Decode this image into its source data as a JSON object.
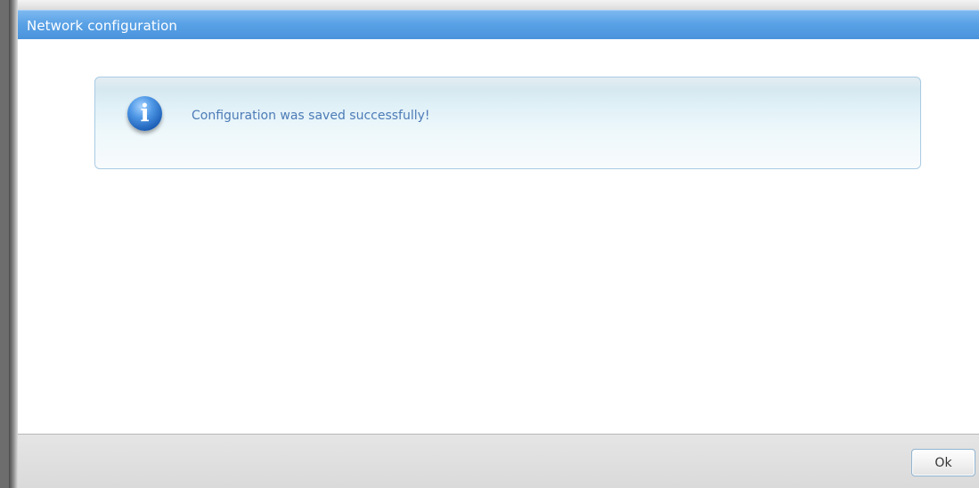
{
  "window": {
    "title": "Network configuration"
  },
  "message": {
    "icon": "info-icon",
    "icon_glyph": "i",
    "text": "Configuration was saved successfully!"
  },
  "footer": {
    "ok_label": "Ok"
  },
  "colors": {
    "title_bar": "#5aa2e6",
    "message_text": "#4d7bb7",
    "info_border": "#a9cbe3"
  }
}
